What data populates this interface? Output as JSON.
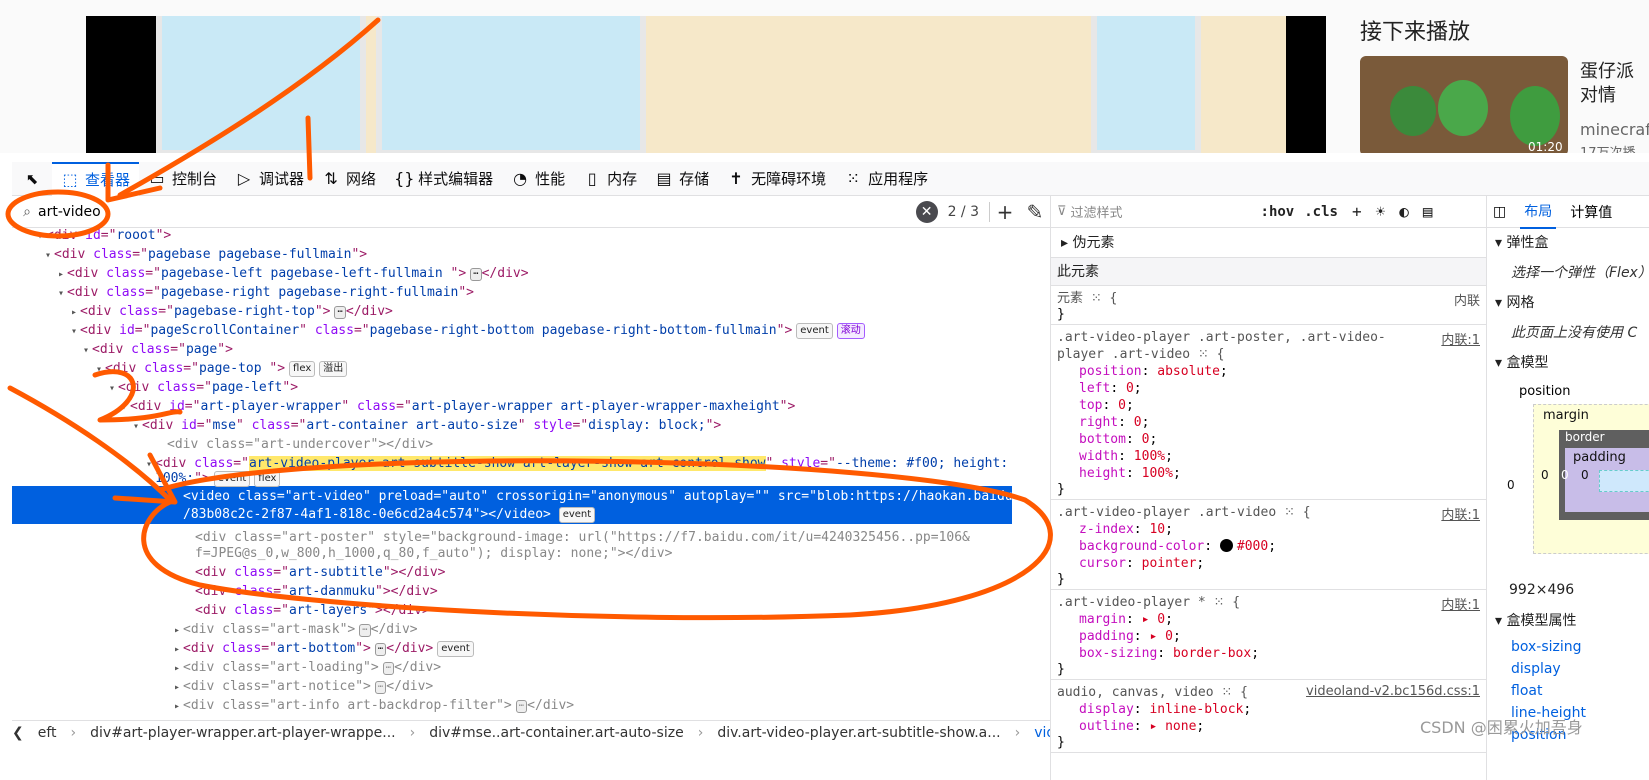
{
  "preview": {
    "next_title": "接下来播放",
    "rec_title": "蛋仔派对情",
    "rec_sub": "minecraf",
    "rec_views": "17万次播",
    "duration": "01:20"
  },
  "toolbar": {
    "tabs": [
      {
        "label": "查看器",
        "icon": "inspector-icon",
        "glyph": "⬚",
        "active": true
      },
      {
        "label": "控制台",
        "icon": "console-icon",
        "glyph": "▭"
      },
      {
        "label": "调试器",
        "icon": "debugger-icon",
        "glyph": "▷"
      },
      {
        "label": "网络",
        "icon": "network-icon",
        "glyph": "⇅"
      },
      {
        "label": "样式编辑器",
        "icon": "style-editor-icon",
        "glyph": "{}"
      },
      {
        "label": "性能",
        "icon": "performance-icon",
        "glyph": "◔"
      },
      {
        "label": "内存",
        "icon": "memory-icon",
        "glyph": "▯"
      },
      {
        "label": "存储",
        "icon": "storage-icon",
        "glyph": "▤"
      },
      {
        "label": "无障碍环境",
        "icon": "accessibility-icon",
        "glyph": "✝"
      },
      {
        "label": "应用程序",
        "icon": "application-icon",
        "glyph": "⁙"
      }
    ]
  },
  "search": {
    "value": "art-video",
    "count": "2 / 3"
  },
  "markup": {
    "lines": [
      {
        "tw": "▾",
        "parts": [
          [
            "t",
            "<div "
          ],
          [
            "a",
            "id"
          ],
          [
            "t",
            "=\""
          ],
          [
            "v",
            "rooot"
          ],
          [
            "t",
            "\">"
          ]
        ]
      },
      {
        "tw": "▾",
        "parts": [
          [
            "t",
            "<div "
          ],
          [
            "a",
            "class"
          ],
          [
            "t",
            "=\""
          ],
          [
            "v",
            "pagebase pagebase-fullmain"
          ],
          [
            "t",
            "\">"
          ]
        ]
      },
      {
        "tw": "▸",
        "parts": [
          [
            "t",
            "<div "
          ],
          [
            "a",
            "class"
          ],
          [
            "t",
            "=\""
          ],
          [
            "v",
            "pagebase-left pagebase-left-fullmain "
          ],
          [
            "t",
            "\">"
          ],
          [
            "e",
            "⋯"
          ],
          [
            "t",
            "</div>"
          ]
        ]
      },
      {
        "tw": "▾",
        "parts": [
          [
            "t",
            "<div "
          ],
          [
            "a",
            "class"
          ],
          [
            "t",
            "=\""
          ],
          [
            "v",
            "pagebase-right pagebase-right-fullmain"
          ],
          [
            "t",
            "\">"
          ]
        ]
      },
      {
        "tw": "▸",
        "parts": [
          [
            "t",
            "<div "
          ],
          [
            "a",
            "class"
          ],
          [
            "t",
            "=\""
          ],
          [
            "v",
            "pagebase-right-top"
          ],
          [
            "t",
            "\">"
          ],
          [
            "e",
            "⋯"
          ],
          [
            "t",
            "</div>"
          ]
        ]
      },
      {
        "tw": "▾",
        "parts": [
          [
            "t",
            "<div "
          ],
          [
            "a",
            "id"
          ],
          [
            "t",
            "=\""
          ],
          [
            "v",
            "pageScrollContainer"
          ],
          [
            "t",
            "\" "
          ],
          [
            "a",
            "class"
          ],
          [
            "t",
            "=\""
          ],
          [
            "v",
            "pagebase-right-bottom pagebase-right-bottom-fullmain"
          ],
          [
            "t",
            "\">"
          ],
          [
            "b",
            "event"
          ],
          [
            "s",
            "滚动"
          ]
        ]
      },
      {
        "tw": "▾",
        "parts": [
          [
            "t",
            "<div "
          ],
          [
            "a",
            "class"
          ],
          [
            "t",
            "=\""
          ],
          [
            "v",
            "page"
          ],
          [
            "t",
            "\">"
          ]
        ]
      },
      {
        "tw": "▾",
        "parts": [
          [
            "t",
            "<div "
          ],
          [
            "a",
            "class"
          ],
          [
            "t",
            "=\""
          ],
          [
            "v",
            "page-top "
          ],
          [
            "t",
            "\">"
          ],
          [
            "b",
            "flex"
          ],
          [
            "b",
            "溢出"
          ]
        ]
      },
      {
        "tw": "▾",
        "parts": [
          [
            "t",
            "<div "
          ],
          [
            "a",
            "class"
          ],
          [
            "t",
            "=\""
          ],
          [
            "v",
            "page-left"
          ],
          [
            "t",
            "\">"
          ]
        ]
      },
      {
        "tw": "▾",
        "parts": [
          [
            "t",
            "<div "
          ],
          [
            "a",
            "id"
          ],
          [
            "t",
            "=\""
          ],
          [
            "v",
            "art-player-wrapper"
          ],
          [
            "t",
            "\" "
          ],
          [
            "a",
            "class"
          ],
          [
            "t",
            "=\""
          ],
          [
            "v",
            "art-player-wrapper art-player-wrapper-maxheight"
          ],
          [
            "t",
            "\">"
          ]
        ]
      },
      {
        "tw": "▾",
        "parts": [
          [
            "t",
            "<div "
          ],
          [
            "a",
            "id"
          ],
          [
            "t",
            "=\""
          ],
          [
            "v",
            "mse"
          ],
          [
            "t",
            "\" "
          ],
          [
            "a",
            "class"
          ],
          [
            "t",
            "=\""
          ],
          [
            "v",
            "art-container art-auto-size"
          ],
          [
            "t",
            "\" "
          ],
          [
            "a",
            "style"
          ],
          [
            "t",
            "=\""
          ],
          [
            "v",
            "display: block;"
          ],
          [
            "t",
            "\">"
          ]
        ]
      },
      {
        "tw": "",
        "dim": true,
        "parts": [
          [
            "t",
            "<div "
          ],
          [
            "a",
            "class"
          ],
          [
            "t",
            "=\""
          ],
          [
            "v",
            "art-undercover"
          ],
          [
            "t",
            "\"></div>"
          ]
        ]
      },
      {
        "tw": "▾",
        "parts": [
          [
            "t",
            "<div "
          ],
          [
            "a",
            "class"
          ],
          [
            "t",
            "=\""
          ],
          [
            "h",
            "art-video-player art-subtitle-show art-layer-show art-control-show"
          ],
          [
            "t",
            "\" "
          ],
          [
            "a",
            "style"
          ],
          [
            "t",
            "=\""
          ],
          [
            "v",
            "--theme: #f00; height:"
          ]
        ]
      },
      {
        "tw": "",
        "parts": [
          [
            "v",
            "100%;"
          ],
          [
            "t",
            "\">"
          ],
          [
            "b",
            "event"
          ],
          [
            "b",
            "flex"
          ]
        ]
      }
    ],
    "selected": {
      "line1": "<video class=\"art-video\" preload=\"auto\" crossorigin=\"anonymous\" autoplay=\"\" src=\"blob:https://haokan.baidu.com",
      "line2": "/83b08c2c-2f87-4af1-818c-0e6cd2a4c574\"></video>",
      "badge": "event"
    },
    "after": [
      {
        "tw": "",
        "dim": true,
        "parts": [
          [
            "t",
            "<div "
          ],
          [
            "a",
            "class"
          ],
          [
            "t",
            "=\""
          ],
          [
            "v",
            "art-poster"
          ],
          [
            "t",
            "\" "
          ],
          [
            "a",
            "style"
          ],
          [
            "t",
            "=\""
          ],
          [
            "v",
            "background-image: url(\"https://f7.baidu.com/it/u=4240325456..pp=106&"
          ]
        ]
      },
      {
        "tw": "",
        "dim": true,
        "parts": [
          [
            "v",
            "f=JPEG@s_0,w_800,h_1000,q_80,f_auto\"); display: none;"
          ],
          [
            "t",
            "\"></div>"
          ]
        ]
      },
      {
        "tw": "",
        "parts": [
          [
            "t",
            "<div "
          ],
          [
            "a",
            "class"
          ],
          [
            "t",
            "=\""
          ],
          [
            "v",
            "art-subtitle"
          ],
          [
            "t",
            "\"></div>"
          ]
        ]
      },
      {
        "tw": "",
        "parts": [
          [
            "t",
            "<div "
          ],
          [
            "a",
            "class"
          ],
          [
            "t",
            "=\""
          ],
          [
            "v",
            "art-danmuku"
          ],
          [
            "t",
            "\"></div>"
          ]
        ]
      },
      {
        "tw": "",
        "parts": [
          [
            "t",
            "<div "
          ],
          [
            "a",
            "class"
          ],
          [
            "t",
            "=\""
          ],
          [
            "v",
            "art-layers"
          ],
          [
            "t",
            "\"></div>"
          ]
        ]
      },
      {
        "tw": "▸",
        "dim": true,
        "parts": [
          [
            "t",
            "<div "
          ],
          [
            "a",
            "class"
          ],
          [
            "t",
            "=\""
          ],
          [
            "v",
            "art-mask"
          ],
          [
            "t",
            "\">"
          ],
          [
            "e",
            "⋯"
          ],
          [
            "t",
            "</div>"
          ]
        ]
      },
      {
        "tw": "▸",
        "parts": [
          [
            "t",
            "<div "
          ],
          [
            "a",
            "class"
          ],
          [
            "t",
            "=\""
          ],
          [
            "v",
            "art-bottom"
          ],
          [
            "t",
            "\">"
          ],
          [
            "e",
            "⋯"
          ],
          [
            "t",
            "</div>"
          ],
          [
            "b",
            "event"
          ]
        ]
      },
      {
        "tw": "▸",
        "dim": true,
        "parts": [
          [
            "t",
            "<div "
          ],
          [
            "a",
            "class"
          ],
          [
            "t",
            "=\""
          ],
          [
            "v",
            "art-loading"
          ],
          [
            "t",
            "\">"
          ],
          [
            "e",
            "⋯"
          ],
          [
            "t",
            "</div>"
          ]
        ]
      },
      {
        "tw": "▸",
        "dim": true,
        "parts": [
          [
            "t",
            "<div "
          ],
          [
            "a",
            "class"
          ],
          [
            "t",
            "=\""
          ],
          [
            "v",
            "art-notice"
          ],
          [
            "t",
            "\">"
          ],
          [
            "e",
            "⋯"
          ],
          [
            "t",
            "</div>"
          ]
        ]
      },
      {
        "tw": "▸",
        "dim": true,
        "parts": [
          [
            "t",
            "<div "
          ],
          [
            "a",
            "class"
          ],
          [
            "t",
            "=\""
          ],
          [
            "v",
            "art-info art-backdrop-filter"
          ],
          [
            "t",
            "\">"
          ],
          [
            "e",
            "⋯"
          ],
          [
            "t",
            "</div>"
          ]
        ]
      }
    ]
  },
  "breadcrumb": [
    "eft",
    "div#art-player-wrapper.art-player-wrappe...",
    "div#mse..art-container.art-auto-size",
    "div.art-video-player.art-subtitle-show.a...",
    "video.art-video"
  ],
  "rules": {
    "filter_placeholder": "过滤样式",
    "hov": ":hov",
    "cls": ".cls",
    "pseudo": "伪元素",
    "this_element": "此元素",
    "element_rule": {
      "sel": "元素 ⁙ {",
      "src": "内联",
      "close": "}"
    },
    "blocks": [
      {
        "sel": ".art-video-player .art-poster, .art-video-player .art-video ⁙ {",
        "src": "内联:1",
        "decls": [
          [
            "position",
            "absolute"
          ],
          [
            "left",
            "0"
          ],
          [
            "top",
            "0"
          ],
          [
            "right",
            "0"
          ],
          [
            "bottom",
            "0"
          ],
          [
            "width",
            "100%"
          ],
          [
            "height",
            "100%"
          ]
        ]
      },
      {
        "sel": ".art-video-player .art-video ⁙ {",
        "src": "内联:1",
        "decls": [
          [
            "z-index",
            "10"
          ],
          [
            "background-color",
            "#000"
          ],
          [
            "cursor",
            "pointer"
          ]
        ]
      },
      {
        "sel": ".art-video-player * ⁙ {",
        "src": "内联:1",
        "decls": [
          [
            "margin",
            "▸ 0"
          ],
          [
            "padding",
            "▸ 0"
          ],
          [
            "box-sizing",
            "border-box"
          ]
        ]
      },
      {
        "sel": "audio, canvas, video ⁙ {",
        "src": "videoland-v2.bc156d.css:1",
        "decls": [
          [
            "display",
            "inline-block"
          ],
          [
            "outline",
            "▸ none"
          ]
        ]
      }
    ]
  },
  "layout": {
    "tabs": [
      "布局",
      "计算值"
    ],
    "flex": "弹性盒",
    "flex_hint": "选择一个弹性（Flex）",
    "grid": "网格",
    "grid_hint": "此页面上没有使用 C",
    "boxmodel": "盒模型",
    "position": "position",
    "margin": "margin",
    "border": "border",
    "padding": "padding",
    "zero": "0",
    "size": "992×496",
    "props_title": "盒模型属性",
    "props": [
      "box-sizing",
      "display",
      "float",
      "line-height",
      "position"
    ]
  },
  "watermark": "CSDN @困累火加吾身",
  "colors": {
    "accent": "#0060df",
    "annotation": "#ff5a00"
  }
}
